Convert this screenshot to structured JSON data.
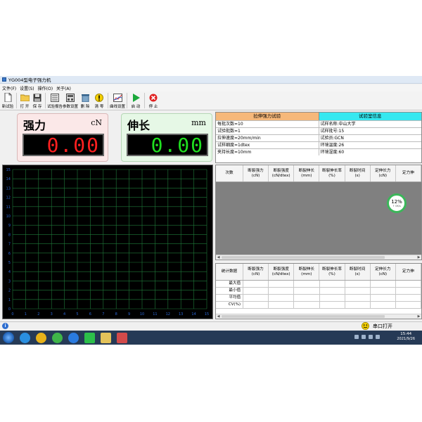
{
  "window": {
    "title": "YG004型电子强力机"
  },
  "menu": [
    "文件(F)",
    "设置(S)",
    "操作(O)",
    "关于(A)"
  ],
  "toolbar": [
    {
      "label": "新试验",
      "icon": "new-document-icon"
    },
    {
      "label": "打 开",
      "icon": "folder-open-icon"
    },
    {
      "label": "保 存",
      "icon": "save-icon"
    },
    {
      "label": "试验报告",
      "icon": "report-icon"
    },
    {
      "label": "参数设置",
      "icon": "settings-icon"
    },
    {
      "label": "删 除",
      "icon": "trash-icon"
    },
    {
      "label": "清 零",
      "icon": "warning-icon"
    },
    {
      "label": "曲线设置",
      "icon": "curve-icon"
    },
    {
      "label": "启 动",
      "icon": "play-icon"
    },
    {
      "label": "停 止",
      "icon": "stop-icon"
    }
  ],
  "readouts": {
    "force": {
      "title": "强力",
      "unit": "cN",
      "value": "0.00"
    },
    "elongation": {
      "title": "伸长",
      "unit": "mm",
      "value": "0.00"
    }
  },
  "info": {
    "left_header": "拉伸强力试验",
    "right_header": "试验室信息",
    "rows": [
      [
        "每批次数=10",
        "试样名称:中山大学"
      ],
      [
        "试验批数=1",
        "试样批号:15"
      ],
      [
        "拉伸速度=20mm/min",
        "试验员:GCN"
      ],
      [
        "试样细度=1dtex",
        "环境温度:26"
      ],
      [
        "夹持长度=10mm",
        "环境湿度:60"
      ]
    ]
  },
  "chart": {
    "x_ticks": [
      "0",
      "1",
      "2",
      "3",
      "4",
      "5",
      "6",
      "7",
      "8",
      "9",
      "10",
      "11",
      "12",
      "13",
      "14",
      "15"
    ],
    "y_ticks": [
      "0",
      "1",
      "2",
      "3",
      "4",
      "5",
      "6",
      "7",
      "8",
      "9",
      "10",
      "11",
      "12",
      "13",
      "14",
      "15"
    ],
    "grid": true,
    "grid_color": "#1f7a3a",
    "tick_color": "#2a66d6"
  },
  "grid": {
    "first_col": "次数",
    "columns": [
      [
        "断裂强力",
        "(cN)"
      ],
      [
        "断裂强度",
        "(cN/dtex)"
      ],
      [
        "断裂伸长",
        "(mm)"
      ],
      [
        "断裂伸长率",
        "(%)"
      ],
      [
        "断裂时间",
        "(s)"
      ],
      [
        "定伸长力",
        "(cN)"
      ],
      [
        "定力伸",
        ""
      ]
    ]
  },
  "progress_badge": {
    "value": "12%",
    "sub": "↑ 0K/s"
  },
  "stats": {
    "first_col": "统计数据",
    "rows": [
      "最大值",
      "最小值",
      "平均值",
      "CV(%)"
    ]
  },
  "status": {
    "text": "串口打开"
  },
  "taskbar": {
    "time": "15:44",
    "date": "2021/9/26",
    "apps": [
      {
        "icon": "start-icon",
        "color": "#1a5bb0"
      },
      {
        "icon": "browser-icon",
        "color": "#2a8fe0"
      },
      {
        "icon": "chrome-icon",
        "color": "#e7b21a"
      },
      {
        "icon": "360-browser-icon",
        "color": "#3fb549"
      },
      {
        "icon": "k-app-icon",
        "color": "#2a7be0"
      },
      {
        "icon": "wechat-work-icon",
        "color": "#2cbf4a"
      },
      {
        "icon": "file-explorer-icon",
        "color": "#e3c25a"
      },
      {
        "icon": "strength-app-icon",
        "color": "#d24a4a"
      }
    ]
  }
}
